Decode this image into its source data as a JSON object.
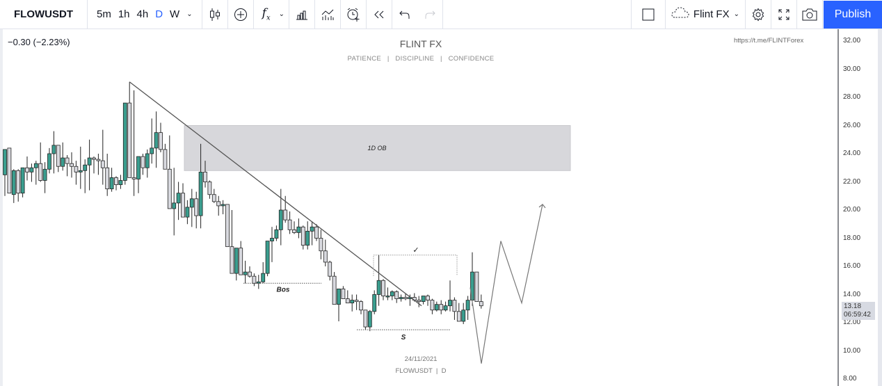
{
  "toolbar": {
    "symbol": "FLOWUSDT",
    "intervals": [
      {
        "label": "5m",
        "active": false
      },
      {
        "label": "1h",
        "active": false
      },
      {
        "label": "4h",
        "active": false
      },
      {
        "label": "D",
        "active": true
      },
      {
        "label": "W",
        "active": false
      }
    ],
    "icons_left": [
      "candles-icon",
      "compare-add-icon",
      "indicators-fx-icon",
      "financials-bars-icon",
      "templates-icon",
      "alert-icon",
      "replay-icon",
      "undo-icon",
      "redo-icon"
    ],
    "layout_name": "Flint FX",
    "publish_label": "Publish"
  },
  "legend": {
    "change": "−0.30 (−2.23%)"
  },
  "watermark": {
    "title": "FLINT FX",
    "subtitle": "PATIENCE   |   DISCIPLINE   |   CONFIDENCE",
    "url": "https://t.me/FLINTForex",
    "date": "24/11/2021",
    "symbol_interval": "FLOWUSDT  |  D"
  },
  "price_axis": {
    "ticks": [
      "32.00",
      "30.00",
      "28.00",
      "26.00",
      "24.00",
      "22.00",
      "20.00",
      "18.00",
      "16.00",
      "14.00",
      "12.00",
      "10.00",
      "8.00"
    ],
    "last_price": "13.18",
    "countdown": "06:59:42"
  },
  "colors": {
    "bull": "#3a9e8f",
    "bear": "#d9dae0",
    "wick": "#222222",
    "zone": "#d7d7db",
    "publish": "#2962ff",
    "active_interval": "#2962ff"
  },
  "annotations": {
    "zone_label": "1D OB",
    "zone_range": [
      22.8,
      26.0
    ],
    "bos_label": "Bos",
    "bos_level": 14.8,
    "s_label": "S",
    "s_level": 11.5,
    "check_label": "✓",
    "check_level": 16.8,
    "trendline": [
      [
        29.1
      ],
      [
        13.2
      ]
    ],
    "projection_levels": [
      14.5,
      9.1,
      17.8,
      13.4,
      20.4
    ]
  },
  "chart_data": {
    "type": "candlestick",
    "symbol": "FLOWUSDT",
    "interval": "D",
    "ylim": [
      8,
      32
    ],
    "candles": [
      [
        22.5,
        24.3,
        21.0,
        24.3
      ],
      [
        24.4,
        24.4,
        21.2,
        21.2
      ],
      [
        21.1,
        22.9,
        20.5,
        22.8
      ],
      [
        22.8,
        22.9,
        20.6,
        21.2
      ],
      [
        21.2,
        23.0,
        20.9,
        23.0
      ],
      [
        23.0,
        23.8,
        22.1,
        22.7
      ],
      [
        22.7,
        23.3,
        22.0,
        23.0
      ],
      [
        23.0,
        23.5,
        21.8,
        23.3
      ],
      [
        23.3,
        24.8,
        22.0,
        22.1
      ],
      [
        22.1,
        23.4,
        21.2,
        22.9
      ],
      [
        22.9,
        24.4,
        22.6,
        24.0
      ],
      [
        24.0,
        25.6,
        22.6,
        24.6
      ],
      [
        24.6,
        24.6,
        22.7,
        23.1
      ],
      [
        23.1,
        24.8,
        22.8,
        23.7
      ],
      [
        23.7,
        23.9,
        22.4,
        23.3
      ],
      [
        23.3,
        24.1,
        22.3,
        23.1
      ],
      [
        23.1,
        23.5,
        21.8,
        22.7
      ],
      [
        22.7,
        24.5,
        21.5,
        22.8
      ],
      [
        22.8,
        23.6,
        21.2,
        23.2
      ],
      [
        23.2,
        25.0,
        21.4,
        23.7
      ],
      [
        23.7,
        23.8,
        22.6,
        23.6
      ],
      [
        23.6,
        24.0,
        22.5,
        23.5
      ],
      [
        23.5,
        25.7,
        21.8,
        23.0
      ],
      [
        23.0,
        24.0,
        21.0,
        21.5
      ],
      [
        21.5,
        23.0,
        21.3,
        22.3
      ],
      [
        22.3,
        22.4,
        21.4,
        21.8
      ],
      [
        21.8,
        22.5,
        21.5,
        22.1
      ],
      [
        22.1,
        27.5,
        21.8,
        27.6
      ],
      [
        27.6,
        29.1,
        22.5,
        22.3
      ],
      [
        22.3,
        28.5,
        21.0,
        22.2
      ],
      [
        22.2,
        23.3,
        21.2,
        23.8
      ],
      [
        23.8,
        24.0,
        22.5,
        23.0
      ],
      [
        23.0,
        24.3,
        22.3,
        24.0
      ],
      [
        24.0,
        26.5,
        23.3,
        24.4
      ],
      [
        24.4,
        27.0,
        23.0,
        25.5
      ],
      [
        25.5,
        26.2,
        24.1,
        24.3
      ],
      [
        24.3,
        24.7,
        23.4,
        22.9
      ],
      [
        22.9,
        25.3,
        20.1,
        20.1
      ],
      [
        20.1,
        23.0,
        18.2,
        20.5
      ],
      [
        20.5,
        22.0,
        19.3,
        21.2
      ],
      [
        21.2,
        21.9,
        19.5,
        19.5
      ],
      [
        19.5,
        20.7,
        19.0,
        20.2
      ],
      [
        20.2,
        21.5,
        18.8,
        20.8
      ],
      [
        20.8,
        21.3,
        18.7,
        19.6
      ],
      [
        19.6,
        24.7,
        18.7,
        22.7
      ],
      [
        22.7,
        23.5,
        21.6,
        22.0
      ],
      [
        22.0,
        22.1,
        20.8,
        21.1
      ],
      [
        21.1,
        21.5,
        20.5,
        20.6
      ],
      [
        20.6,
        21.0,
        19.6,
        20.3
      ],
      [
        20.3,
        20.7,
        19.7,
        20.4
      ],
      [
        20.4,
        20.4,
        17.5,
        17.4
      ],
      [
        17.4,
        20.0,
        15.5,
        15.5
      ],
      [
        15.5,
        17.2,
        15.0,
        17.3
      ],
      [
        17.3,
        17.8,
        15.9,
        15.4
      ],
      [
        15.4,
        16.4,
        14.8,
        15.6
      ],
      [
        15.6,
        16.0,
        15.2,
        15.3
      ],
      [
        15.3,
        15.5,
        14.6,
        14.8
      ],
      [
        14.8,
        15.4,
        14.4,
        14.9
      ],
      [
        14.9,
        16.3,
        14.8,
        15.5
      ],
      [
        15.5,
        17.5,
        15.3,
        17.8
      ],
      [
        17.8,
        18.8,
        16.3,
        18.0
      ],
      [
        18.0,
        18.9,
        17.8,
        18.6
      ],
      [
        18.6,
        21.5,
        17.5,
        20.0
      ],
      [
        20.0,
        21.0,
        19.1,
        19.3
      ],
      [
        19.3,
        19.9,
        18.3,
        18.6
      ],
      [
        18.6,
        19.2,
        18.3,
        18.4
      ],
      [
        18.4,
        19.4,
        18.0,
        18.8
      ],
      [
        18.8,
        18.9,
        17.2,
        17.5
      ],
      [
        17.5,
        19.2,
        17.2,
        18.5
      ],
      [
        18.5,
        19.2,
        17.5,
        18.8
      ],
      [
        18.8,
        19.0,
        17.8,
        18.0
      ],
      [
        18.0,
        18.6,
        16.5,
        17.1
      ],
      [
        17.1,
        17.9,
        16.0,
        16.3
      ],
      [
        16.3,
        16.4,
        15.0,
        15.3
      ],
      [
        15.3,
        15.6,
        13.4,
        13.3
      ],
      [
        13.3,
        14.4,
        12.1,
        14.4
      ],
      [
        14.4,
        14.6,
        13.7,
        13.7
      ],
      [
        13.7,
        14.3,
        13.4,
        13.4
      ],
      [
        13.4,
        14.0,
        12.8,
        13.6
      ],
      [
        13.6,
        14.0,
        12.9,
        13.5
      ],
      [
        13.5,
        13.6,
        12.6,
        12.9
      ],
      [
        12.9,
        12.9,
        11.5,
        11.7
      ],
      [
        11.7,
        12.9,
        11.4,
        12.8
      ],
      [
        12.8,
        14.3,
        12.6,
        14.0
      ],
      [
        14.0,
        16.8,
        13.2,
        15.0
      ],
      [
        15.0,
        15.1,
        13.6,
        13.9
      ],
      [
        13.9,
        14.5,
        13.6,
        13.9
      ],
      [
        13.9,
        14.3,
        13.6,
        14.2
      ],
      [
        14.2,
        14.3,
        13.4,
        13.7
      ],
      [
        13.7,
        14.0,
        13.5,
        13.8
      ],
      [
        13.8,
        14.1,
        13.6,
        13.7
      ],
      [
        13.7,
        14.0,
        13.2,
        13.8
      ],
      [
        13.8,
        14.1,
        13.5,
        13.6
      ],
      [
        13.6,
        13.9,
        13.1,
        13.5
      ],
      [
        13.5,
        13.8,
        13.3,
        13.9
      ],
      [
        13.9,
        14.0,
        13.2,
        13.6
      ],
      [
        13.6,
        13.7,
        12.6,
        12.9
      ],
      [
        12.9,
        13.5,
        12.8,
        13.3
      ],
      [
        13.3,
        13.6,
        12.6,
        12.9
      ],
      [
        12.9,
        13.5,
        12.8,
        13.2
      ],
      [
        13.2,
        15.0,
        12.8,
        13.6
      ],
      [
        13.6,
        13.8,
        12.2,
        12.8
      ],
      [
        12.8,
        13.4,
        12.1,
        12.1
      ],
      [
        12.1,
        13.4,
        11.9,
        12.9
      ],
      [
        12.9,
        13.9,
        12.2,
        13.6
      ],
      [
        13.6,
        17.0,
        13.2,
        15.6
      ],
      [
        15.6,
        15.6,
        13.5,
        13.5
      ],
      [
        13.5,
        14.0,
        13.0,
        13.2
      ]
    ]
  }
}
